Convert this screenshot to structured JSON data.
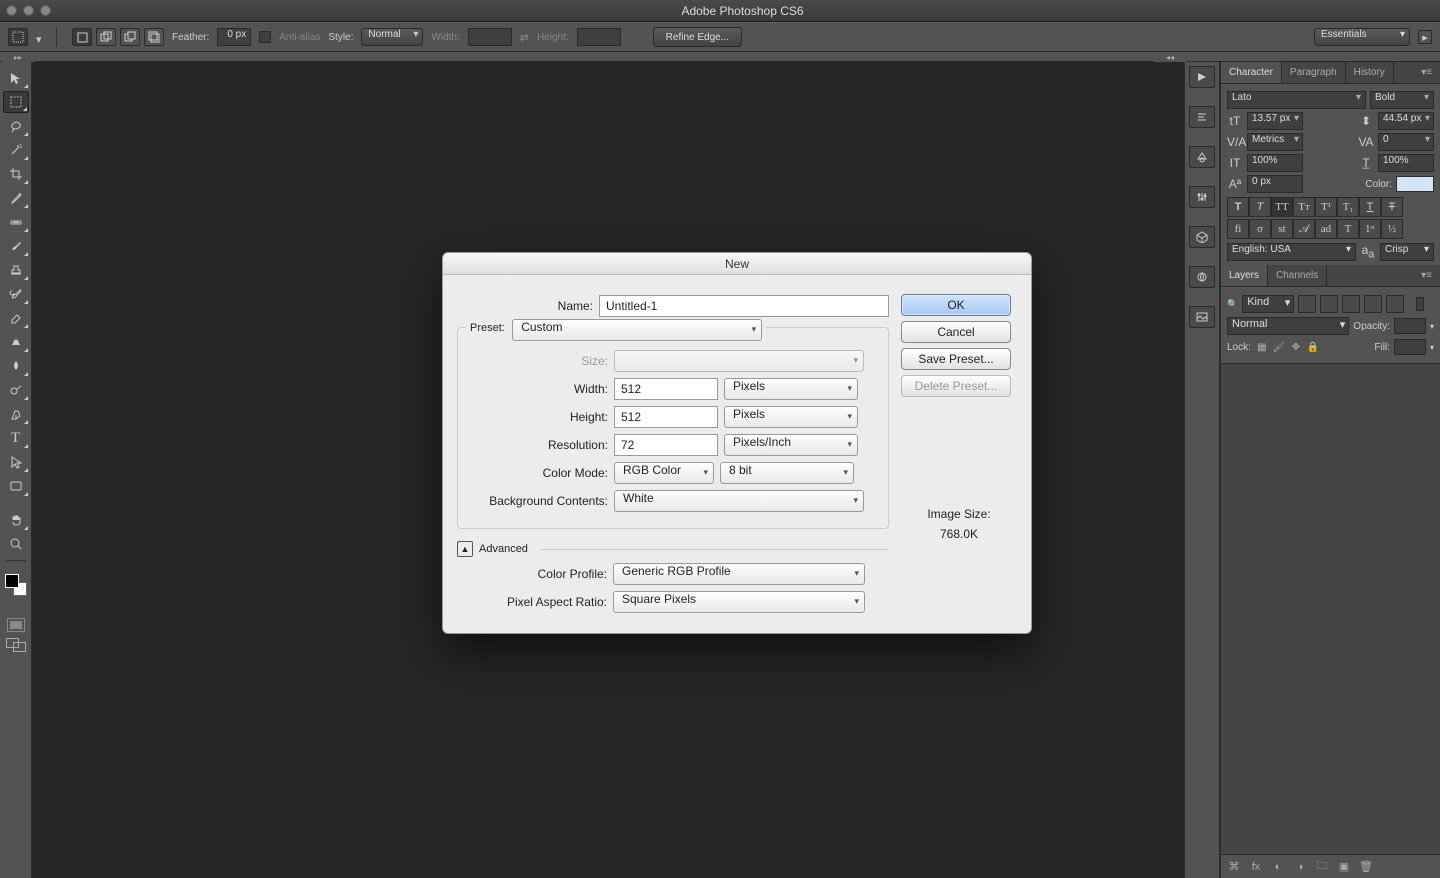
{
  "app_title": "Adobe Photoshop CS6",
  "optionsbar": {
    "feather_label": "Feather:",
    "feather_value": "0 px",
    "antialias_label": "Anti-alias",
    "style_label": "Style:",
    "style_value": "Normal",
    "width_label": "Width:",
    "height_label": "Height:",
    "refine_btn": "Refine Edge...",
    "workspace": "Essentials"
  },
  "dialog": {
    "title": "New",
    "name_label": "Name:",
    "name_value": "Untitled-1",
    "preset_label": "Preset:",
    "preset_value": "Custom",
    "size_label": "Size:",
    "width_label": "Width:",
    "width_value": "512",
    "width_unit": "Pixels",
    "height_label": "Height:",
    "height_value": "512",
    "height_unit": "Pixels",
    "resolution_label": "Resolution:",
    "resolution_value": "72",
    "resolution_unit": "Pixels/Inch",
    "colormode_label": "Color Mode:",
    "colormode_value": "RGB Color",
    "colormode_depth": "8 bit",
    "bg_label": "Background Contents:",
    "bg_value": "White",
    "advanced_label": "Advanced",
    "profile_label": "Color Profile:",
    "profile_value": "Generic RGB Profile",
    "par_label": "Pixel Aspect Ratio:",
    "par_value": "Square Pixels",
    "ok": "OK",
    "cancel": "Cancel",
    "save_preset": "Save Preset...",
    "delete_preset": "Delete Preset...",
    "image_size_label": "Image Size:",
    "image_size_value": "768.0K"
  },
  "character": {
    "tab1": "Character",
    "tab2": "Paragraph",
    "tab3": "History",
    "font": "Lato",
    "style": "Bold",
    "size": "13.57 px",
    "leading": "44.54 px",
    "kern": "Metrics",
    "track": "0",
    "vscale": "100%",
    "hscale": "100%",
    "baseline": "0 px",
    "color_label": "Color:",
    "lang": "English: USA",
    "aa": "Crisp"
  },
  "layers": {
    "tab1": "Layers",
    "tab2": "Channels",
    "kind": "Kind",
    "blend": "Normal",
    "opacity_label": "Opacity:",
    "lock_label": "Lock:",
    "fill_label": "Fill:"
  }
}
